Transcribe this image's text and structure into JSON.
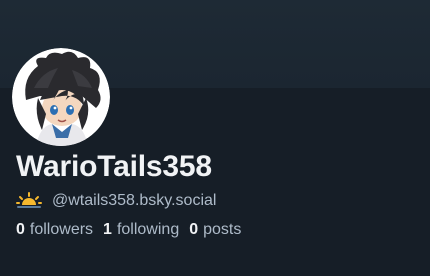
{
  "profile": {
    "display_name": "WarioTails358",
    "handle": "@wtails358.bsky.social",
    "avatar_icon": "avatar-image",
    "status_icon": "sun-icon"
  },
  "stats": {
    "followers_count": "0",
    "followers_label": "followers",
    "following_count": "1",
    "following_label": "following",
    "posts_count": "0",
    "posts_label": "posts"
  },
  "colors": {
    "background": "#161e27",
    "banner": "#1e2a35",
    "name_text": "#f1f3f5",
    "secondary_text": "#aebbc9"
  }
}
